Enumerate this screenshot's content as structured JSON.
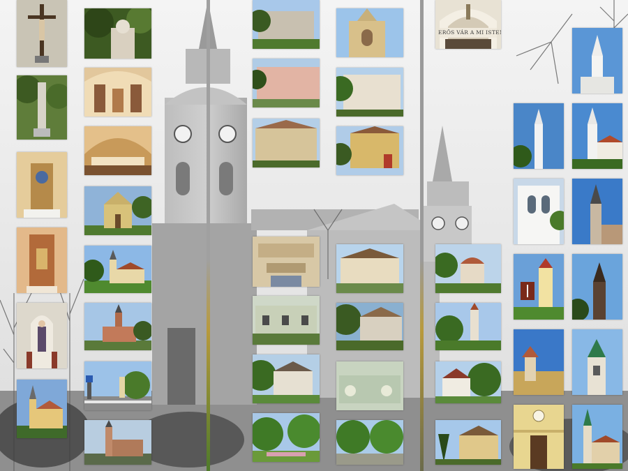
{
  "collage": {
    "inscription_text": "ERŐS VÁR A MI ISTENÜNK",
    "colors": {
      "background": "#e9e9e9",
      "stripe_gold": "#b89a3c",
      "stripe_green": "#4e7a2a"
    }
  }
}
